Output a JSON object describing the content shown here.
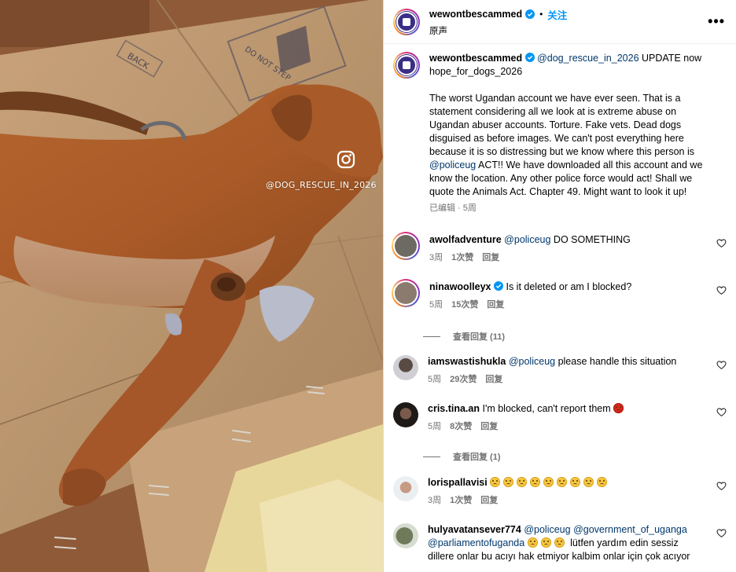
{
  "media": {
    "watermark": "@DOG_RESCUE_IN_2026",
    "box_print_1": "BACK",
    "box_print_2": "DO NOT STEP"
  },
  "header": {
    "username": "wewontbescammed",
    "separator": "•",
    "follow_label": "关注",
    "audio_label": "原声",
    "more_label": "•••"
  },
  "caption": {
    "username": "wewontbescammed",
    "mention": "@dog_rescue_in_2026",
    "line1_rest": " UPDATE now hope_for_dogs_2026",
    "para2_a": "The worst Ugandan account we have ever seen. That is a statement considering all we look at is extreme abuse on Ugandan abuser accounts. Torture. Fake vets. Dead dogs disguised as before images. We can't post everything here because it is so distressing but we know where this person is ",
    "para2_mention": "@policeug",
    "para2_b": " ACT!! We have downloaded all this account and we know the location. Any other police force would act! Shall we quote the Animals Act. Chapter 49. Might want to look it up!",
    "meta": "已编辑 · 5周"
  },
  "comments": [
    {
      "username": "awolfadventure",
      "mention": "@policeug",
      "text": " DO SOMETHING",
      "time": "3周",
      "likes": "1次赞",
      "reply": "回复"
    },
    {
      "username": "ninawoolleyx",
      "text": "Is it deleted or am I blocked?",
      "time": "5周",
      "likes": "15次赞",
      "reply": "回复",
      "view_replies": "查看回复 (11)"
    },
    {
      "username": "iamswastishukla",
      "mention": "@policeug",
      "text": " please handle this situation",
      "time": "5周",
      "likes": "29次赞",
      "reply": "回复"
    },
    {
      "username": "cris.tina.an",
      "text": "I'm blocked, can't report them ",
      "time": "5周",
      "likes": "8次赞",
      "reply": "回复",
      "view_replies": "查看回复 (1)"
    },
    {
      "username": "lorispallavisi",
      "text": "",
      "time": "3周",
      "likes": "1次赞",
      "reply": "回复"
    },
    {
      "username": "hulyavatansever774",
      "mention": "@policeug",
      "mention2": "@government_of_uganga",
      "mention3": "@parliamentofuganda",
      "text": " lütfen yardım edin sessiz dillere onlar bu acıyı hak etmiyor kalbim onlar için çok acıyor"
    }
  ],
  "colors": {
    "link": "#00376b",
    "follow": "#0095f6",
    "meta": "#737373",
    "verified": "#0095f6",
    "border": "#dbdbdb"
  },
  "icons": [
    "instagram-icon",
    "verified-badge-icon",
    "more-options-icon",
    "heart-icon",
    "sad-face-emoji",
    "angry-face-emoji"
  ]
}
